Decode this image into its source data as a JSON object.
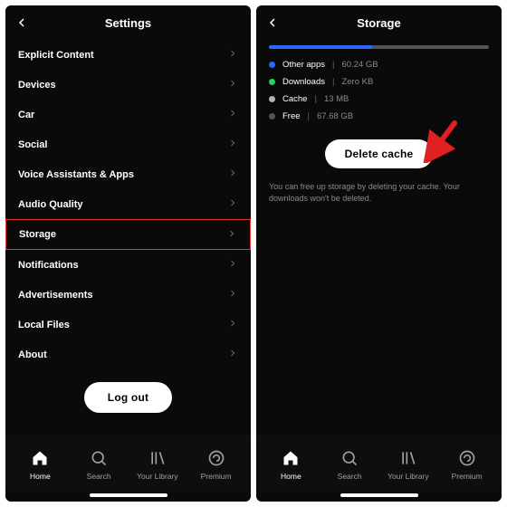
{
  "left": {
    "title": "Settings",
    "items": [
      {
        "label": "Explicit Content"
      },
      {
        "label": "Devices"
      },
      {
        "label": "Car"
      },
      {
        "label": "Social"
      },
      {
        "label": "Voice Assistants & Apps"
      },
      {
        "label": "Audio Quality"
      },
      {
        "label": "Storage",
        "highlight": true
      },
      {
        "label": "Notifications"
      },
      {
        "label": "Advertisements"
      },
      {
        "label": "Local Files"
      },
      {
        "label": "About"
      }
    ],
    "logout": "Log out"
  },
  "right": {
    "title": "Storage",
    "legend": [
      {
        "label": "Other apps",
        "value": "60.24 GB",
        "color": "#2a68ff"
      },
      {
        "label": "Downloads",
        "value": "Zero KB",
        "color": "#1ed760"
      },
      {
        "label": "Cache",
        "value": "13 MB",
        "color": "#b3b3b3"
      },
      {
        "label": "Free",
        "value": "67.68 GB",
        "color": "#535353"
      }
    ],
    "delete": "Delete cache",
    "help": "You can free up storage by deleting your cache. Your downloads won't be deleted."
  },
  "nav": [
    {
      "label": "Home",
      "active": true
    },
    {
      "label": "Search"
    },
    {
      "label": "Your Library"
    },
    {
      "label": "Premium"
    }
  ]
}
